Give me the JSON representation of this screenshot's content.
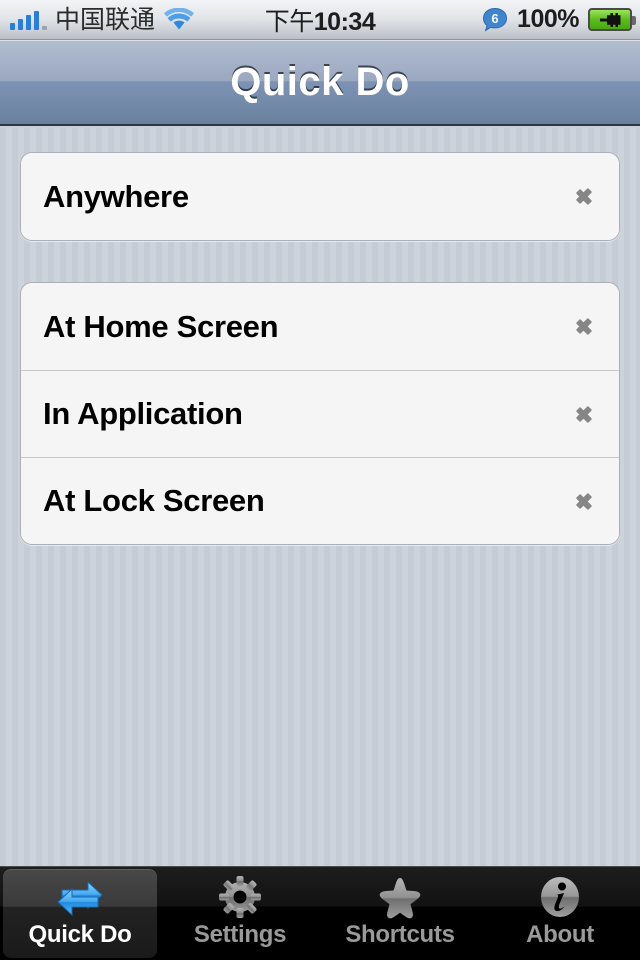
{
  "status_bar": {
    "carrier": "中国联通",
    "signal_icon": "signal-bars-icon",
    "wifi_icon": "wifi-icon",
    "time": "10:34",
    "time_period": "下午",
    "alarm_badge_icon": "alarm-badge-icon",
    "alarm_badge_count": "6",
    "battery_percent": "100%",
    "battery_icon": "battery-charging-icon"
  },
  "nav_bar": {
    "title": "Quick Do"
  },
  "groups": [
    {
      "rows": [
        {
          "label": "Anywhere",
          "accessory": "chevron-right-icon"
        }
      ]
    },
    {
      "rows": [
        {
          "label": "At Home Screen",
          "accessory": "chevron-right-icon"
        },
        {
          "label": "In Application",
          "accessory": "chevron-right-icon"
        },
        {
          "label": "At Lock Screen",
          "accessory": "chevron-right-icon"
        }
      ]
    }
  ],
  "tab_bar": {
    "tabs": [
      {
        "label": "Quick Do",
        "icon": "exchange-arrows-icon",
        "active": true
      },
      {
        "label": "Settings",
        "icon": "gear-icon",
        "active": false
      },
      {
        "label": "Shortcuts",
        "icon": "star-icon",
        "active": false
      },
      {
        "label": "About",
        "icon": "info-circle-icon",
        "active": false
      }
    ]
  },
  "colors": {
    "accent_blue": "#2a7fd4",
    "nav_bar_top": "#b2bdd0",
    "nav_bar_bottom": "#69819f",
    "cell_background": "#f5f5f5",
    "page_background": "#cbd2da",
    "battery_green": "#5dbd1e",
    "tab_bar_background": "#000000"
  }
}
